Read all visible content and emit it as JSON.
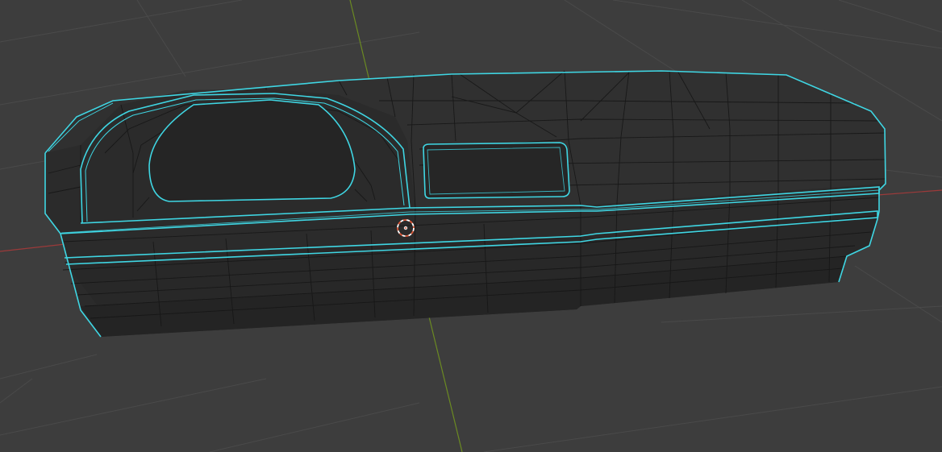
{
  "viewport": {
    "background_color": "#3d3d3d",
    "grid_color": "#4a4a4a",
    "x_axis_color": "#9c3a3a",
    "y_axis_color": "#6b8a22"
  },
  "mesh": {
    "object_type": "dashboard",
    "body_color": "#2b2b2b",
    "top_surface_color": "#303030",
    "edge_wire_color": "#161616",
    "selection_outline_color": "#3fd6e3"
  },
  "cursor_3d": {
    "icon": "3d-cursor-icon",
    "ring_color_a": "#e05a3a",
    "ring_color_b": "#ffffff"
  }
}
